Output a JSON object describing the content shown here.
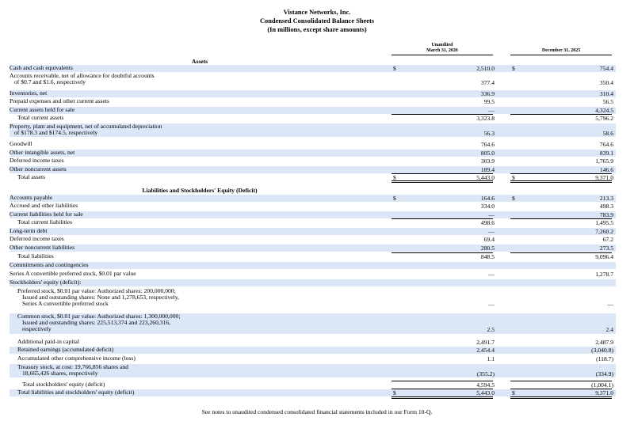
{
  "header": {
    "company": "Vistance Networks, Inc.",
    "title": "Condensed Consolidated Balance Sheets",
    "subtitle": "(In millions, except share amounts)"
  },
  "columns": {
    "c1_line1": "Unaudited",
    "c1_line2": "March 31, 2026",
    "c2": "December 31, 2025"
  },
  "sections": {
    "assets": "Assets",
    "liabilities": "Liabilities and Stockholders' Equity (Deficit)"
  },
  "rows": [
    {
      "label": [
        "Cash and cash equivalents"
      ],
      "v1": "2,510.0",
      "v2": "754.4",
      "cur1": "$",
      "cur2": "$",
      "indent": 0,
      "shade": true
    },
    {
      "label": [
        "Accounts receivable, net of allowance for doubtful accounts",
        "of $0.7 and $1.6, respectively"
      ],
      "v1": "377.4",
      "v2": "350.4",
      "indent": 0,
      "shade": false
    },
    {
      "label": [
        "Inventories, net"
      ],
      "v1": "336.9",
      "v2": "310.4",
      "indent": 0,
      "shade": true
    },
    {
      "label": [
        "Prepaid expenses and other current assets"
      ],
      "v1": "99.5",
      "v2": "56.5",
      "indent": 0,
      "shade": false
    },
    {
      "label": [
        "Current assets held for sale"
      ],
      "v1": "—",
      "v2": "4,324.5",
      "indent": 0,
      "shade": true
    },
    {
      "label": [
        "Total current assets"
      ],
      "v1": "3,323.8",
      "v2": "5,796.2",
      "indent": 1,
      "shade": false
    },
    {
      "label": [
        "Property, plant and equipment, net of accumulated depreciation",
        "of $178.3 and $174.5, respectively"
      ],
      "v1": "56.3",
      "v2": "58.6",
      "indent": 0,
      "shade": true
    },
    {
      "label": [
        "Goodwill"
      ],
      "v1": "764.6",
      "v2": "764.6",
      "indent": 0,
      "shade": false
    },
    {
      "label": [
        "Other intangible assets, net"
      ],
      "v1": "805.0",
      "v2": "839.1",
      "indent": 0,
      "shade": true
    },
    {
      "label": [
        "Deferred income taxes"
      ],
      "v1": "303.9",
      "v2": "1,765.9",
      "indent": 0,
      "shade": false
    },
    {
      "label": [
        "Other noncurrent assets"
      ],
      "v1": "189.4",
      "v2": "146.6",
      "indent": 0,
      "shade": true
    },
    {
      "label": [
        "Total assets"
      ],
      "v1": "5,443.0",
      "v2": "9,371.0",
      "cur1": "$",
      "cur2": "$",
      "indent": 1,
      "shade": false
    },
    {
      "label": [
        "Accounts payable"
      ],
      "v1": "164.6",
      "v2": "213.3",
      "cur1": "$",
      "cur2": "$",
      "indent": 0,
      "shade": true
    },
    {
      "label": [
        "Accrued and other liabilities"
      ],
      "v1": "334.0",
      "v2": "498.3",
      "indent": 0,
      "shade": false
    },
    {
      "label": [
        "Current liabilities held for sale"
      ],
      "v1": "—",
      "v2": "783.9",
      "indent": 0,
      "shade": true
    },
    {
      "label": [
        "Total current liabilities"
      ],
      "v1": "498.6",
      "v2": "1,495.5",
      "indent": 1,
      "shade": false
    },
    {
      "label": [
        "Long-term debt"
      ],
      "v1": "—",
      "v2": "7,260.2",
      "indent": 0,
      "shade": true
    },
    {
      "label": [
        "Deferred income taxes"
      ],
      "v1": "69.4",
      "v2": "67.2",
      "indent": 0,
      "shade": false
    },
    {
      "label": [
        "Other noncurrent liabilities"
      ],
      "v1": "280.5",
      "v2": "273.5",
      "indent": 0,
      "shade": true
    },
    {
      "label": [
        "Total liabilities"
      ],
      "v1": "848.5",
      "v2": "9,096.4",
      "indent": 1,
      "shade": false
    },
    {
      "label": [
        "Commitments and contingencies"
      ],
      "v1": "",
      "v2": "",
      "indent": 0,
      "shade": true
    },
    {
      "label": [
        "Series A convertible preferred stock, $0.01 par value"
      ],
      "v1": "—",
      "v2": "1,278.7",
      "indent": 0,
      "shade": false
    },
    {
      "label": [
        "Stockholders' equity (deficit):"
      ],
      "v1": "",
      "v2": "",
      "indent": 0,
      "shade": true
    },
    {
      "label": [
        "Preferred stock, $0.01 par value: Authorized shares: 200,000,000;",
        "Issued and outstanding shares: None and 1,278,653, respectively,",
        "Series A convertible preferred stock"
      ],
      "v1": "—",
      "v2": "—",
      "indent": 1,
      "shade": false
    },
    {
      "label": [
        "Common stock, $0.01 par value: Authorized shares: 1,300,000,000;",
        "Issued and outstanding shares: 225,513,374 and 223,260,316,",
        "respectively"
      ],
      "v1": "2.5",
      "v2": "2.4",
      "indent": 1,
      "shade": true
    },
    {
      "label": [
        "Additional paid-in capital"
      ],
      "v1": "2,491.7",
      "v2": "2,487.9",
      "indent": 1,
      "shade": false
    },
    {
      "label": [
        "Retained earnings (accumulated deficit)"
      ],
      "v1": "2,454.4",
      "v2": "(3,040.8)",
      "indent": 1,
      "shade": true
    },
    {
      "label": [
        "Accumulated other comprehensive income (loss)"
      ],
      "v1": "1.1",
      "v2": "(118.7)",
      "indent": 1,
      "shade": false
    },
    {
      "label": [
        "Treasury stock, at cost: 19,766,856 shares and",
        "18,665,426 shares, respectively"
      ],
      "v1": "(355.2)",
      "v2": "(334.9)",
      "indent": 1,
      "shade": true
    },
    {
      "label": [
        "Total stockholders' equity (deficit)"
      ],
      "v1": "4,594.5",
      "v2": "(1,004.1)",
      "indent": 2,
      "shade": false
    },
    {
      "label": [
        "Total liabilities and stockholders' equity (deficit)"
      ],
      "v1": "5,443.0",
      "v2": "9,371.0",
      "cur1": "$",
      "cur2": "$",
      "indent": 1,
      "shade": true
    }
  ],
  "footer": "See notes to unaudited condensed consolidated financial statements included in our Form 10-Q."
}
